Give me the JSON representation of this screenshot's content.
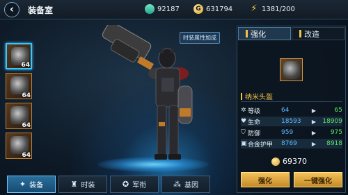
{
  "header": {
    "back_icon": "back-arrow-icon",
    "title": "装备室",
    "resources": [
      {
        "icon": "gem-icon",
        "value": "92187"
      },
      {
        "icon": "gold-coin-icon",
        "value": "631794"
      },
      {
        "icon": "energy-bolt-icon",
        "value": "1381/200"
      }
    ]
  },
  "equipment_slots": [
    {
      "level": "64",
      "selected": true
    },
    {
      "level": "64",
      "selected": false
    },
    {
      "level": "64",
      "selected": false
    },
    {
      "level": "64",
      "selected": false
    }
  ],
  "hero": {
    "tooltip": "时装属性加成"
  },
  "bottom_tabs": [
    {
      "label": "装备",
      "icon": "shirt-icon",
      "active": true
    },
    {
      "label": "时装",
      "icon": "costume-icon",
      "active": false
    },
    {
      "label": "军衔",
      "icon": "rank-icon",
      "active": false
    },
    {
      "label": "基因",
      "icon": "gene-icon",
      "active": false
    }
  ],
  "panel": {
    "tabs": [
      {
        "label": "强化",
        "active": true
      },
      {
        "label": "改造",
        "active": false
      }
    ],
    "item_name": "纳米头盔",
    "stats": [
      {
        "icon": "gear-icon",
        "name": "等级",
        "current": "64",
        "next": "65"
      },
      {
        "icon": "heart-icon",
        "name": "生命",
        "current": "18593",
        "next": "18909"
      },
      {
        "icon": "shield-icon",
        "name": "防御",
        "current": "959",
        "next": "975"
      },
      {
        "icon": "armor-icon",
        "name": "合金护甲",
        "current": "8769",
        "next": "8918"
      }
    ],
    "cost": "69370",
    "buttons": {
      "enhance": "强化",
      "one_click_enhance": "一键强化"
    }
  },
  "colors": {
    "accent_blue": "#39c7ff",
    "gold": "#f0c04a",
    "next_value_green": "#5fe06a",
    "current_value_blue": "#5fb8ff"
  }
}
